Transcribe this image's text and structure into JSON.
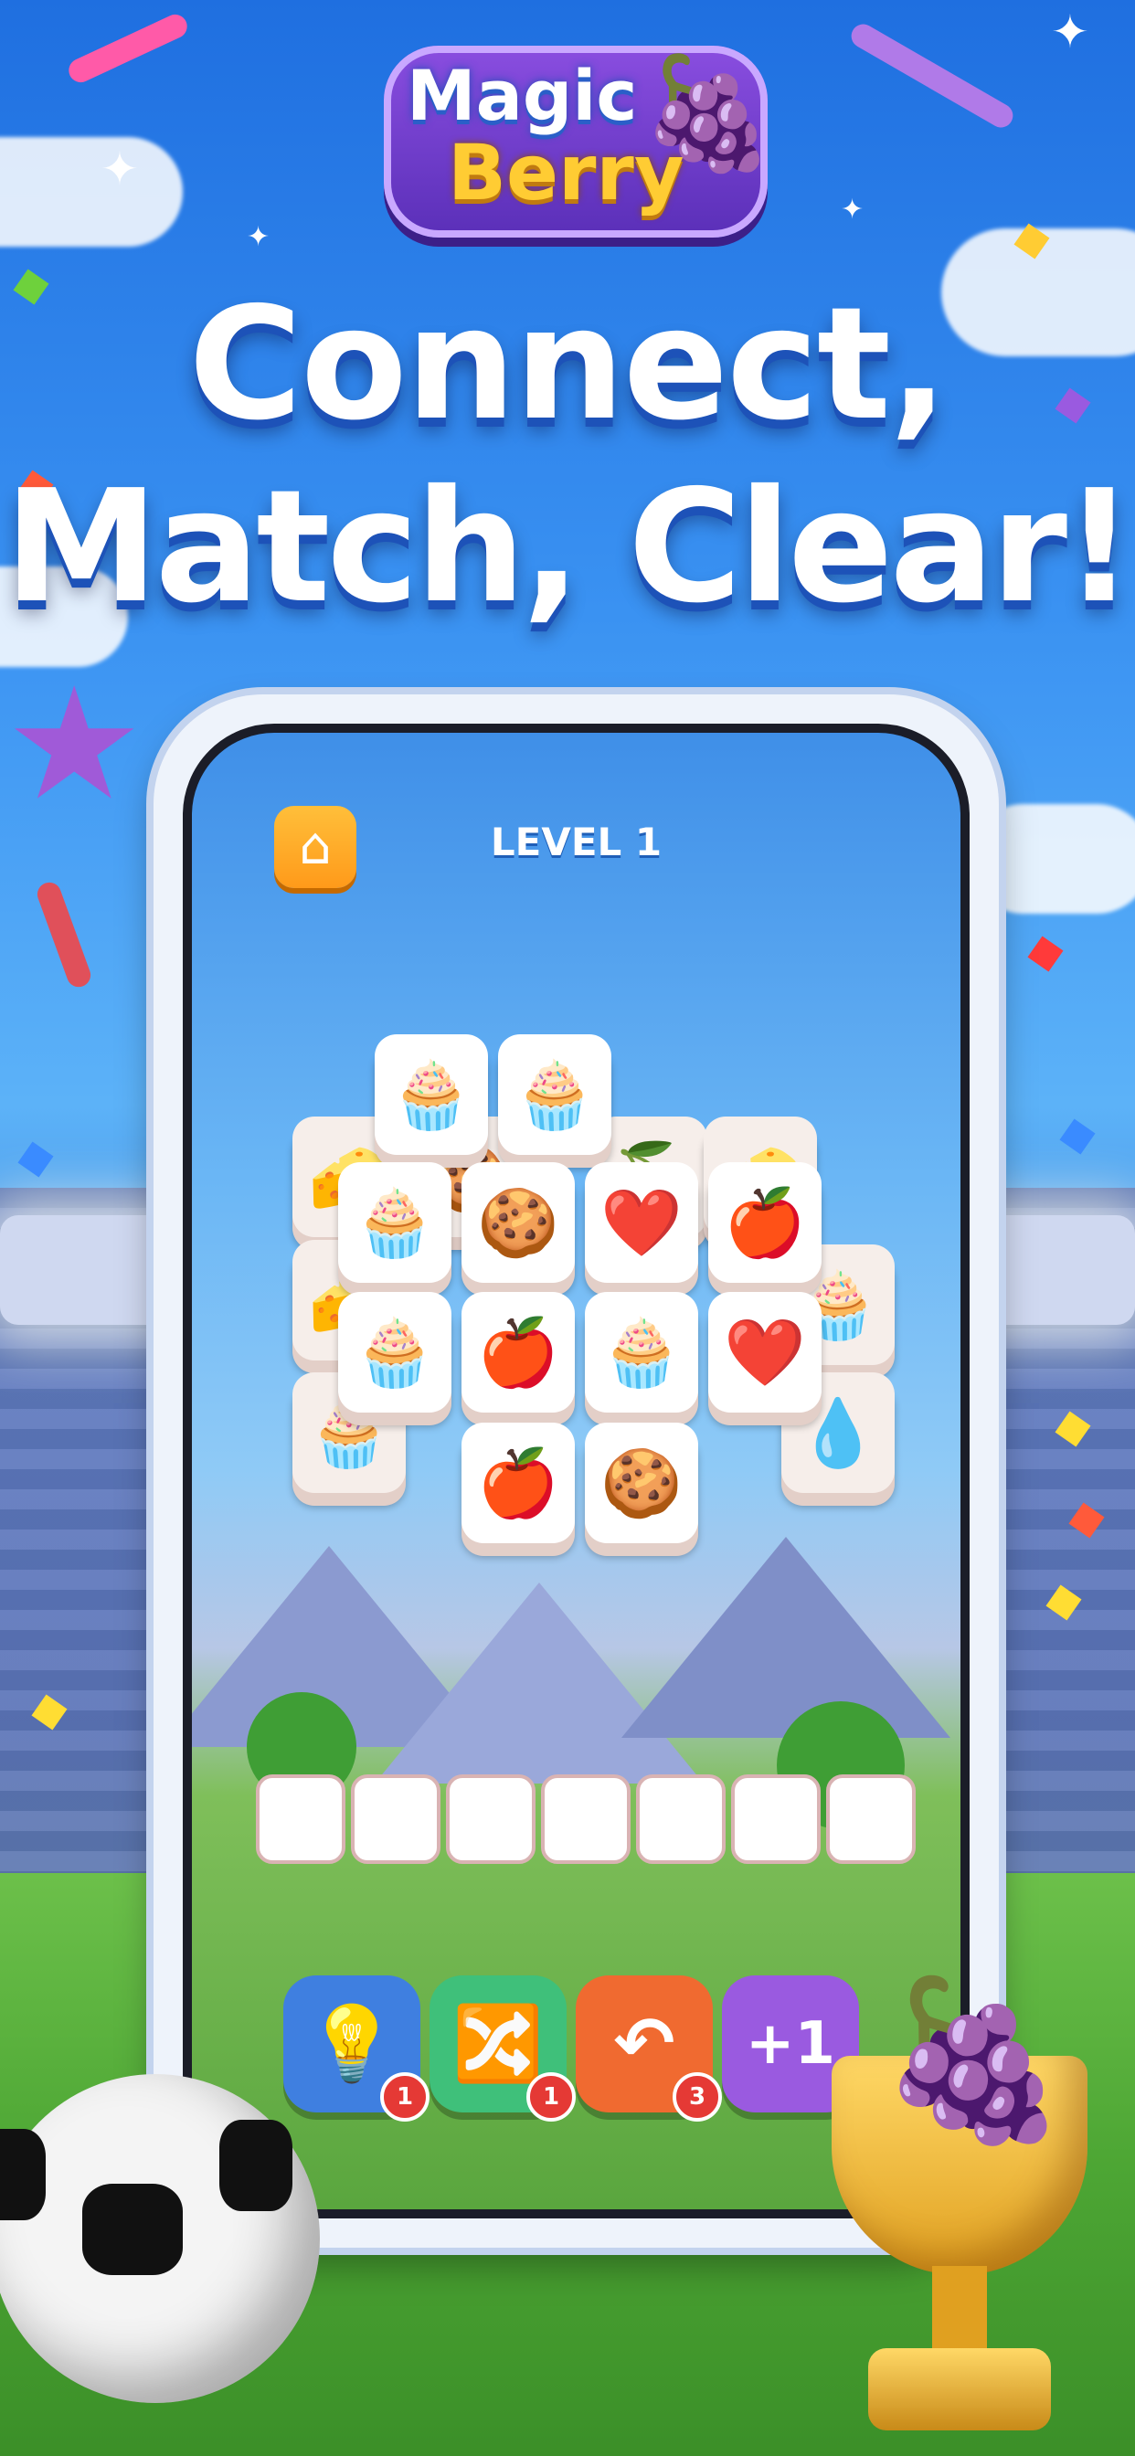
{
  "logo": {
    "line1": "Magic",
    "line2": "Berry"
  },
  "headline": {
    "line1": "Connect,",
    "line2": "Match, Clear!"
  },
  "game": {
    "level_label": "LEVEL 1",
    "home_icon": "home-icon",
    "tiles": [
      {
        "item": "🧀"
      },
      {
        "item": "🍪"
      },
      {
        "item": "🍒"
      },
      {
        "item": "🧀"
      },
      {
        "item": "🧁"
      },
      {
        "item": "🧁"
      },
      {
        "item": "🧁"
      },
      {
        "item": "🍪"
      },
      {
        "item": "❤️"
      },
      {
        "item": "🍎"
      },
      {
        "item": "🧁"
      },
      {
        "item": "🍎"
      },
      {
        "item": "🧁"
      },
      {
        "item": "❤️"
      },
      {
        "item": "🍎"
      },
      {
        "item": "🍪"
      },
      {
        "item": "🧀"
      },
      {
        "item": "🧁"
      },
      {
        "item": "🧁"
      },
      {
        "item": "💧"
      }
    ],
    "slots_count": 7,
    "powerups": [
      {
        "name": "hint",
        "icon": "lightbulb-icon",
        "glyph": "💡",
        "count": "1",
        "color": "#3f7fe0"
      },
      {
        "name": "shuffle",
        "icon": "shuffle-icon",
        "glyph": "🔀",
        "count": "1",
        "color": "#3fc07a"
      },
      {
        "name": "undo",
        "icon": "undo-icon",
        "glyph": "↶",
        "count": "3",
        "color": "#f06a30"
      },
      {
        "name": "extra-slot",
        "icon": "plus-one-icon",
        "glyph": "+1",
        "count": "",
        "color": "#9a5ae0"
      }
    ]
  },
  "colors": {
    "sky": "#3a92f2",
    "grass": "#4da634",
    "logo_purple": "#6a3bc8",
    "gold": "#ffcc33"
  }
}
